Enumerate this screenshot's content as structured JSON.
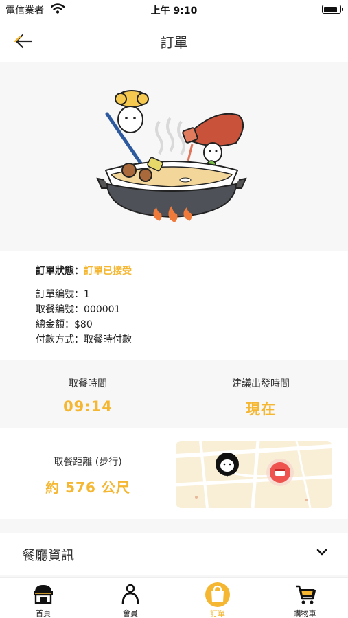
{
  "status_bar": {
    "carrier": "電信業者",
    "time": "上午 9:10",
    "battery_level": 0.9
  },
  "nav": {
    "title": "訂單"
  },
  "order": {
    "status_label": "訂單狀態：",
    "status_value": "訂單已接受",
    "lines": [
      "訂單編號：1",
      "取餐編號：000001",
      "總金額：$80",
      "付款方式：取餐時付款"
    ]
  },
  "pickup": {
    "time_label": "取餐時間",
    "time_value": "09:14",
    "depart_label": "建議出發時間",
    "depart_value": "現在"
  },
  "distance": {
    "label": "取餐距離 (步行)",
    "value": "約 576 公尺"
  },
  "restaurant": {
    "title": "餐廳資訊"
  },
  "tabs": [
    {
      "label": "首頁",
      "icon": "store-icon"
    },
    {
      "label": "會員",
      "icon": "person-icon"
    },
    {
      "label": "訂單",
      "icon": "bag-icon",
      "active": true
    },
    {
      "label": "購物車",
      "icon": "cart-icon"
    }
  ],
  "colors": {
    "accent": "#f5b731",
    "pin_red": "#ef5350",
    "map_bg": "#f8efd6"
  }
}
